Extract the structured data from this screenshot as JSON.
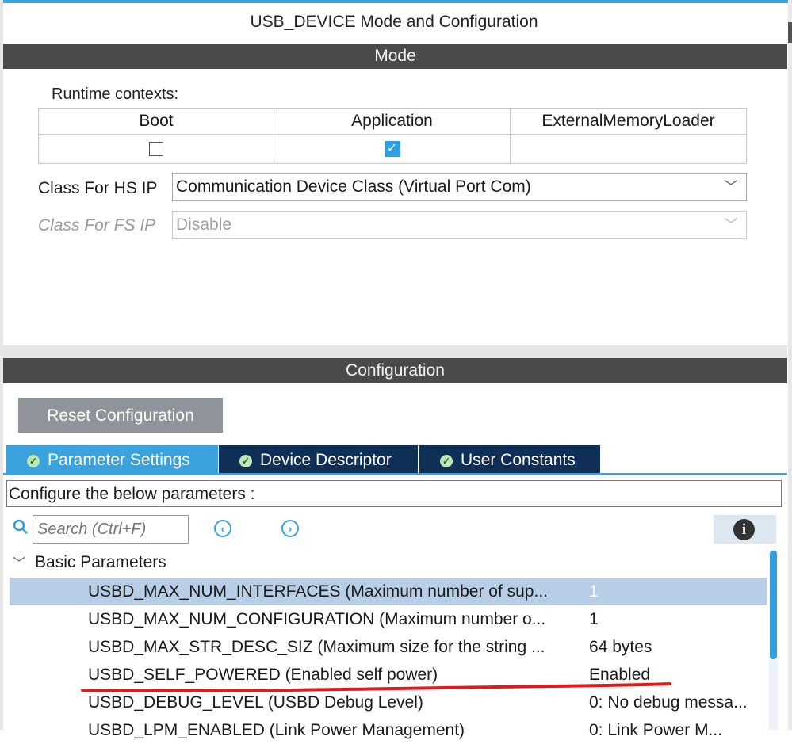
{
  "window_title": "USB_DEVICE Mode and Configuration",
  "mode": {
    "header": "Mode",
    "runtime_label": "Runtime contexts:",
    "contexts": [
      {
        "label": "Boot",
        "checked": false
      },
      {
        "label": "Application",
        "checked": true
      },
      {
        "label": "ExternalMemoryLoader",
        "checked": null
      }
    ],
    "hs_label": "Class For HS IP",
    "hs_value": "Communication Device Class (Virtual Port Com)",
    "fs_label": "Class For FS IP",
    "fs_value": "Disable"
  },
  "configuration": {
    "header": "Configuration",
    "reset_label": "Reset Configuration",
    "tabs": [
      {
        "label": "Parameter Settings",
        "active": true
      },
      {
        "label": "Device Descriptor",
        "active": false
      },
      {
        "label": "User Constants",
        "active": false
      }
    ],
    "instructions": "Configure the below parameters :",
    "search_placeholder": "Search (Ctrl+F)",
    "group": "Basic Parameters",
    "params": [
      {
        "name": "USBD_MAX_NUM_INTERFACES (Maximum number of sup...",
        "value": "1",
        "selected": true
      },
      {
        "name": "USBD_MAX_NUM_CONFIGURATION (Maximum number o...",
        "value": "1",
        "selected": false
      },
      {
        "name": "USBD_MAX_STR_DESC_SIZ (Maximum size for the string ...",
        "value": "64 bytes",
        "selected": false
      },
      {
        "name": "USBD_SELF_POWERED (Enabled self power)",
        "value": "Enabled",
        "selected": false
      },
      {
        "name": "USBD_DEBUG_LEVEL (USBD Debug Level)",
        "value": "0: No debug messa...",
        "selected": false
      },
      {
        "name": "USBD_LPM_ENABLED (Link Power Management)",
        "value": "0: Link Power M...",
        "selected": false
      }
    ]
  },
  "colors": {
    "accent": "#3aa3de",
    "tab_dark": "#0f2f57",
    "header_bar": "#4a4a4a",
    "annotation": "#e01b1b"
  }
}
